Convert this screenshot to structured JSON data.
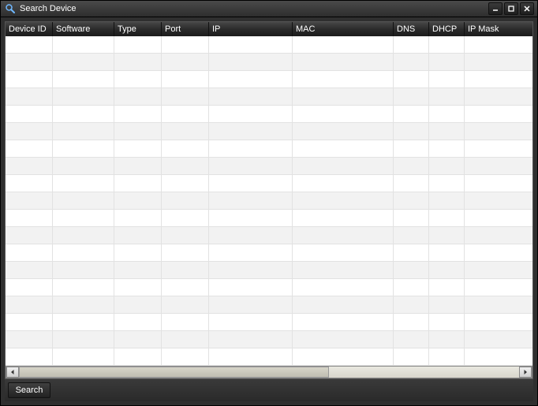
{
  "window": {
    "title": "Search Device"
  },
  "table": {
    "columns": [
      "Device ID",
      "Software",
      "Type",
      "Port",
      "IP",
      "MAC",
      "DNS",
      "DHCP",
      "IP Mask"
    ],
    "rows": [
      [
        "",
        "",
        "",
        "",
        "",
        "",
        "",
        "",
        ""
      ],
      [
        "",
        "",
        "",
        "",
        "",
        "",
        "",
        "",
        ""
      ],
      [
        "",
        "",
        "",
        "",
        "",
        "",
        "",
        "",
        ""
      ],
      [
        "",
        "",
        "",
        "",
        "",
        "",
        "",
        "",
        ""
      ],
      [
        "",
        "",
        "",
        "",
        "",
        "",
        "",
        "",
        ""
      ],
      [
        "",
        "",
        "",
        "",
        "",
        "",
        "",
        "",
        ""
      ],
      [
        "",
        "",
        "",
        "",
        "",
        "",
        "",
        "",
        ""
      ],
      [
        "",
        "",
        "",
        "",
        "",
        "",
        "",
        "",
        ""
      ],
      [
        "",
        "",
        "",
        "",
        "",
        "",
        "",
        "",
        ""
      ],
      [
        "",
        "",
        "",
        "",
        "",
        "",
        "",
        "",
        ""
      ],
      [
        "",
        "",
        "",
        "",
        "",
        "",
        "",
        "",
        ""
      ],
      [
        "",
        "",
        "",
        "",
        "",
        "",
        "",
        "",
        ""
      ],
      [
        "",
        "",
        "",
        "",
        "",
        "",
        "",
        "",
        ""
      ],
      [
        "",
        "",
        "",
        "",
        "",
        "",
        "",
        "",
        ""
      ],
      [
        "",
        "",
        "",
        "",
        "",
        "",
        "",
        "",
        ""
      ],
      [
        "",
        "",
        "",
        "",
        "",
        "",
        "",
        "",
        ""
      ],
      [
        "",
        "",
        "",
        "",
        "",
        "",
        "",
        "",
        ""
      ],
      [
        "",
        "",
        "",
        "",
        "",
        "",
        "",
        "",
        ""
      ],
      [
        "",
        "",
        "",
        "",
        "",
        "",
        "",
        "",
        ""
      ]
    ]
  },
  "buttons": {
    "search": "Search"
  }
}
